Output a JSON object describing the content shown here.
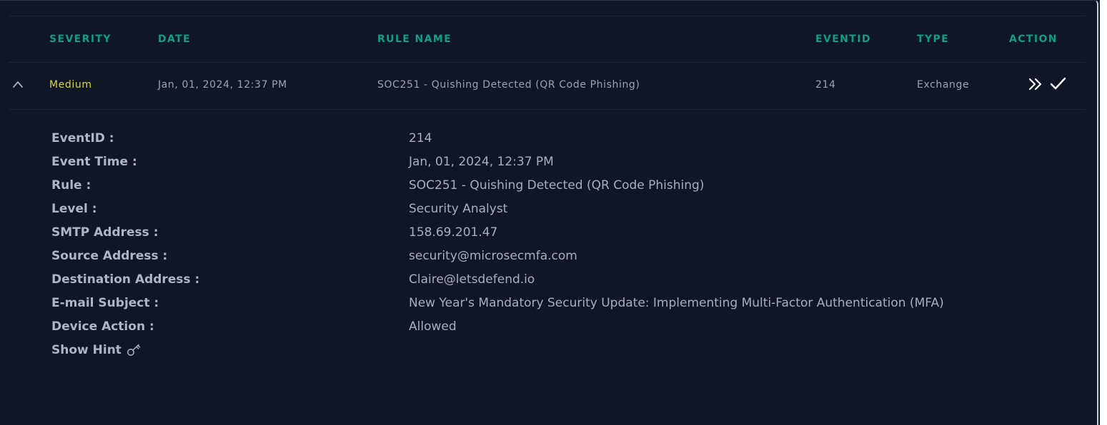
{
  "table": {
    "headers": [
      "SEVERITY",
      "DATE",
      "RULE NAME",
      "EVENTID",
      "TYPE",
      "ACTION"
    ],
    "row": {
      "severity": "Medium",
      "date": "Jan, 01, 2024, 12:37 PM",
      "rule_name": "SOC251 - Quishing Detected (QR Code Phishing)",
      "event_id": "214",
      "type": "Exchange",
      "action_icons": [
        "double-chevron-right-icon",
        "checkmark-icon"
      ]
    }
  },
  "details": [
    {
      "label": "EventID :",
      "value": "214"
    },
    {
      "label": "Event Time :",
      "value": "Jan, 01, 2024, 12:37 PM"
    },
    {
      "label": "Rule :",
      "value": "SOC251 - Quishing Detected (QR Code Phishing)"
    },
    {
      "label": "Level :",
      "value": "Security Analyst"
    },
    {
      "label": "SMTP Address :",
      "value": "158.69.201.47"
    },
    {
      "label": "Source Address :",
      "value": "security@microsecmfa.com"
    },
    {
      "label": "Destination Address :",
      "value": "Claire@letsdefend.io"
    },
    {
      "label": "E-mail Subject :",
      "value": "New Year's Mandatory Security Update: Implementing Multi-Factor Authentication (MFA)"
    },
    {
      "label": "Device Action :",
      "value": "Allowed"
    }
  ],
  "show_hint": {
    "label": "Show Hint",
    "icon": "key-icon"
  },
  "colors": {
    "background": "#0f1726",
    "header_accent": "#0f9d86",
    "severity_medium": "#e0d33a",
    "text": "#9aa3b2"
  }
}
